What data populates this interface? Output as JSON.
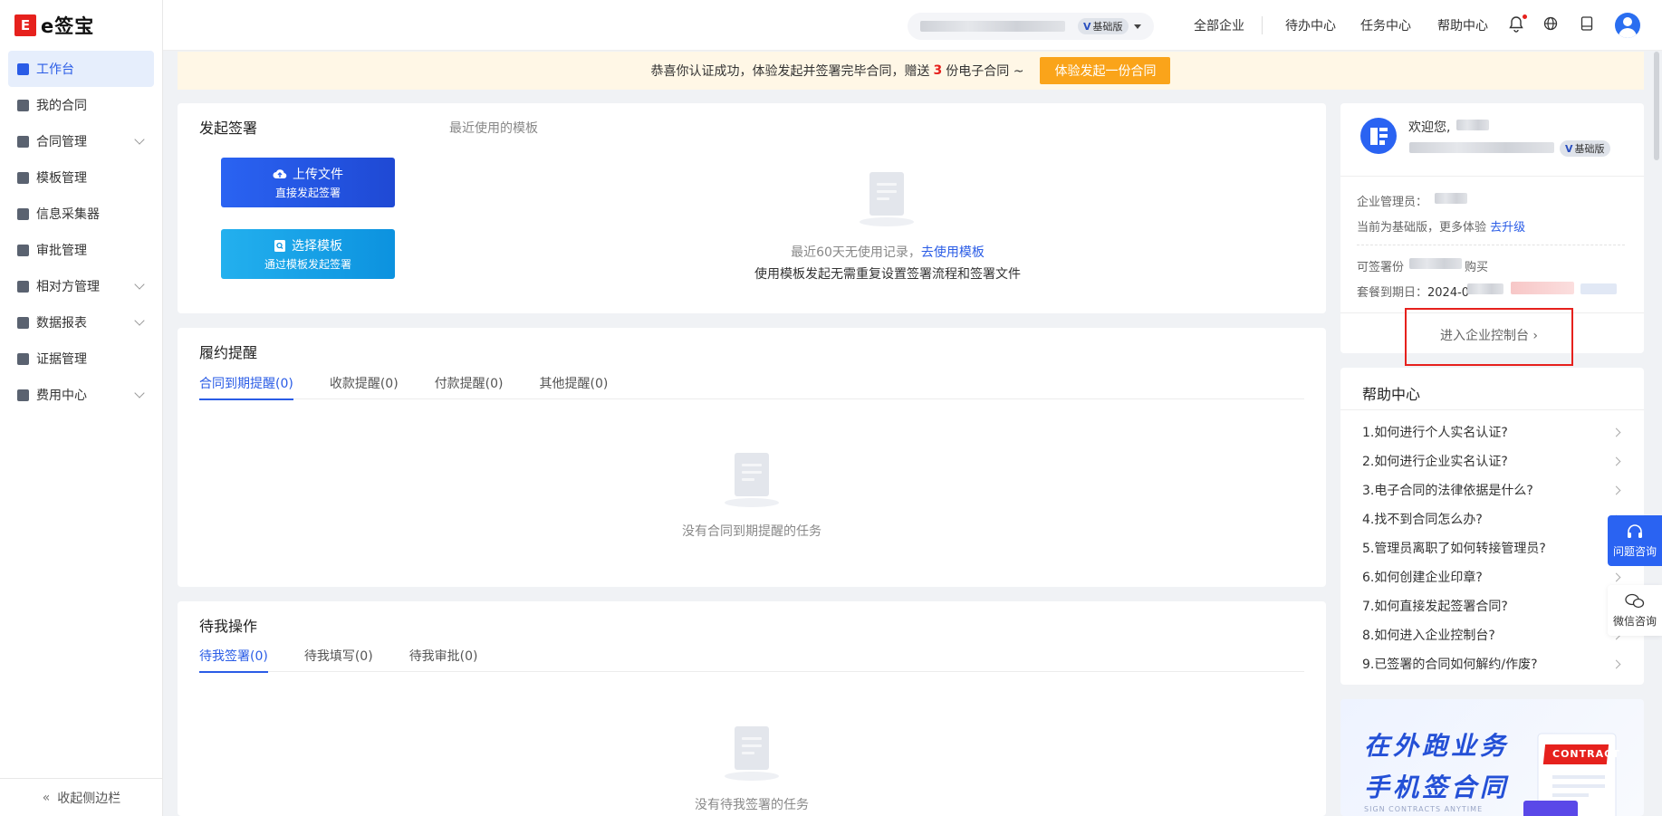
{
  "brand": {
    "mark": "E",
    "name": "e签宝"
  },
  "sidebar": {
    "items": [
      {
        "label": "工作台",
        "icon": "home-icon",
        "active": true,
        "expandable": false
      },
      {
        "label": "我的合同",
        "icon": "contract-icon",
        "active": false,
        "expandable": false
      },
      {
        "label": "合同管理",
        "icon": "contract-manage-icon",
        "active": false,
        "expandable": true
      },
      {
        "label": "模板管理",
        "icon": "template-icon",
        "active": false,
        "expandable": false
      },
      {
        "label": "信息采集器",
        "icon": "grid-icon",
        "active": false,
        "expandable": false
      },
      {
        "label": "审批管理",
        "icon": "approval-icon",
        "active": false,
        "expandable": false
      },
      {
        "label": "相对方管理",
        "icon": "counterparty-icon",
        "active": false,
        "expandable": true
      },
      {
        "label": "数据报表",
        "icon": "report-icon",
        "active": false,
        "expandable": true
      },
      {
        "label": "证据管理",
        "icon": "bookmark-icon",
        "active": false,
        "expandable": false
      },
      {
        "label": "费用中心",
        "icon": "fee-icon",
        "active": false,
        "expandable": true
      }
    ],
    "collapse_label": "收起侧边栏"
  },
  "topbar": {
    "version_badge": "基础版",
    "links": [
      "全部企业",
      "待办中心",
      "任务中心",
      "帮助中心"
    ]
  },
  "banner": {
    "text_before": "恭喜你认证成功，体验发起并签署完毕合同，赠送",
    "highlight": "3",
    "text_after": "份电子合同 ~",
    "button": "体验发起一份合同"
  },
  "initiate": {
    "title": "发起签署",
    "recent_title": "最近使用的模板",
    "upload_btn": {
      "line1": "上传文件",
      "line2": "直接发起签署"
    },
    "template_btn": {
      "line1": "选择模板",
      "line2": "通过模板发起签署"
    },
    "empty_line1": "最近60天无使用记录，",
    "empty_link": "去使用模板",
    "empty_line2": "使用模板发起无需重复设置签署流程和签署文件"
  },
  "reminder": {
    "title": "履约提醒",
    "tabs": [
      "合同到期提醒(0)",
      "收款提醒(0)",
      "付款提醒(0)",
      "其他提醒(0)"
    ],
    "empty": "没有合同到期提醒的任务"
  },
  "pending": {
    "title": "待我操作",
    "tabs": [
      "待我签署(0)",
      "待我填写(0)",
      "待我审批(0)"
    ],
    "empty": "没有待我签署的任务"
  },
  "profile": {
    "welcome": "欢迎您,",
    "version_badge": "基础版",
    "admin_label": "企业管理员：",
    "plan_text": "当前为基础版，更多体验",
    "upgrade_link": "去升级",
    "quota_label": "可签署份",
    "buy_link": "购买",
    "expire_label": "套餐到期日：",
    "expire_date": "2024-0",
    "console_link": "进入企业控制台 ›"
  },
  "help": {
    "title": "帮助中心",
    "items": [
      "1.如何进行个人实名认证?",
      "2.如何进行企业实名认证?",
      "3.电子合同的法律依据是什么?",
      "4.找不到合同怎么办?",
      "5.管理员离职了如何转接管理员?",
      "6.如何创建企业印章?",
      "7.如何直接发起签署合同?",
      "8.如何进入企业控制台?",
      "9.已签署的合同如何解约/作废?"
    ]
  },
  "float": {
    "question": "问题咨询",
    "wechat": "微信咨询"
  },
  "ad": {
    "line1": "在外跑业务",
    "line2": "手机签合同",
    "line3": "SIGN CONTRACTS ANYTIME",
    "contract_word": "CONTRACT"
  },
  "colors": {
    "primary": "#2a5ce6",
    "brand_red": "#e6211d",
    "banner_bg": "#fff7e6",
    "banner_button": "#faa41a"
  }
}
